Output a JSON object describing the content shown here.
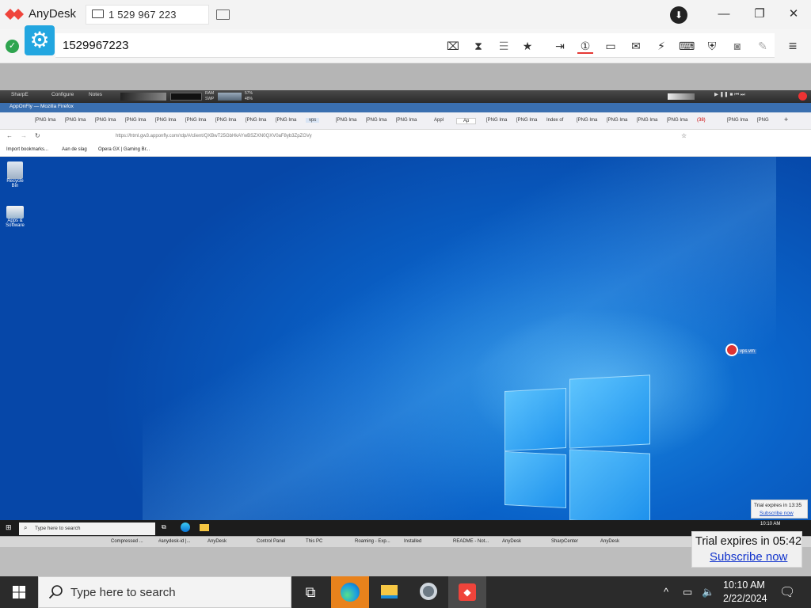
{
  "anydesk": {
    "app_name": "AnyDesk",
    "session_tab": "1 529 967 223",
    "address_value": "1529967223",
    "toolbar_icons": [
      "privacy-icon",
      "hourglass-icon",
      "database-icon",
      "star-icon",
      "file-transfer-icon",
      "display-1-icon",
      "monitor-icon",
      "chat-icon",
      "lightning-icon",
      "keyboard-icon",
      "shield-icon",
      "screenshot-icon",
      "pen-icon",
      "menu-icon"
    ]
  },
  "remote": {
    "sharp_bar": {
      "items": [
        "SharpE",
        "Configure",
        "Notes"
      ],
      "ram": "RAM",
      "swp": "SWP",
      "ram_pct": "57%",
      "swp_pct": "48%"
    },
    "firefox": {
      "window_title": "AppOnFly — Mozilla Firefox",
      "tabs": [
        "[PNG Ima",
        "[PNG Ima",
        "[PNG Ima",
        "[PNG Ima",
        "[PNG Ima",
        "[PNG Ima",
        "[PNG Ima",
        "[PNG Ima",
        "[PNG Ima",
        "vps",
        "[PNG Ima",
        "[PNG Ima",
        "[PNG Ima",
        "Appl",
        "Ap",
        "[PNG Ima",
        "[PNG Ima",
        "Index of",
        "[PNG Ima",
        "[PNG Ima",
        "[PNG Ima",
        "[PNG Ima",
        "(38)",
        "[PNG Ima",
        "[PNG"
      ],
      "url": "https://html.gw3.apponfly.com/rdp/#/client/QXBwT25GbHkAYwBSZXN0QXV0aF8yb3ZpZGVy",
      "bookmarks": [
        "Import bookmarks...",
        "Aan de slag",
        "Opera GX | Gaming Br..."
      ]
    },
    "desktop_icons": [
      "Recycle Bin",
      "Apps & Software"
    ],
    "cursor_label": "vps.vm",
    "trial_small": {
      "text": "Trial expires in 13:35",
      "link": "Subscribe now"
    },
    "taskbar": {
      "search_placeholder": "Type here to search",
      "clock": "10:10 AM"
    },
    "sharp_taskbar": [
      "Compressed ...",
      "#anydesk-id |...",
      "AnyDesk",
      "Control Panel",
      "This PC",
      "Roaming - Exp...",
      "Installed",
      "README - Not...",
      "AnyDesk",
      "SharpCenter",
      "AnyDesk"
    ],
    "trial_big": {
      "text": "Trial expires in 05:42",
      "link": "Subscribe now"
    }
  },
  "local_taskbar": {
    "search_placeholder": "Type here to search",
    "time": "10:10 AM",
    "date": "2/22/2024"
  }
}
